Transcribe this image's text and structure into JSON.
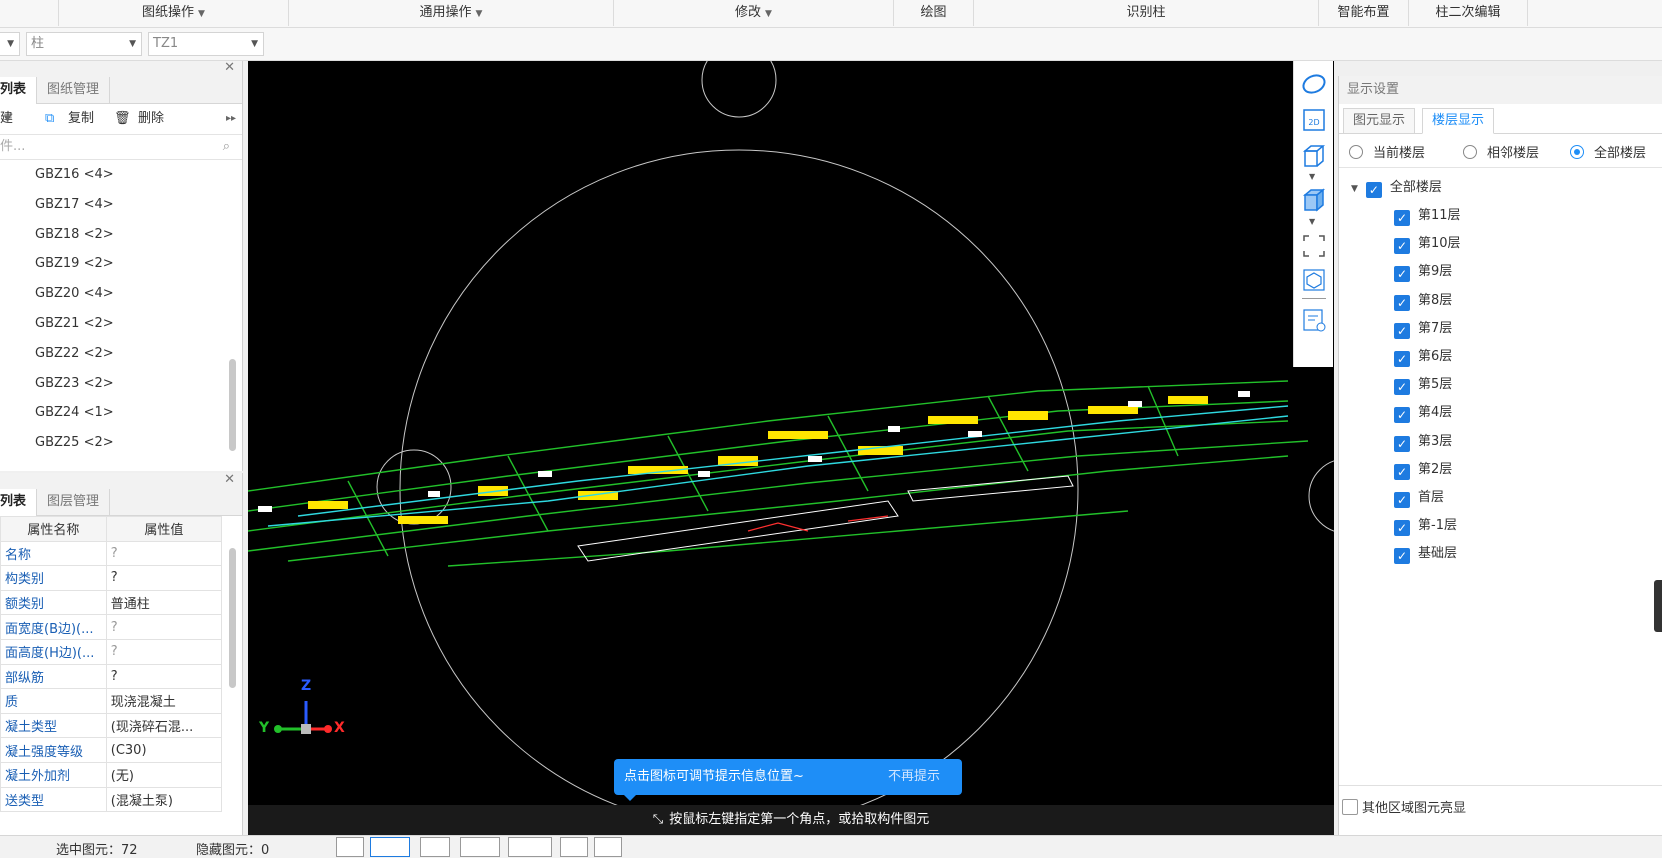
{
  "ribbon": {
    "groups": [
      {
        "label": "图纸操作",
        "dropdown": true
      },
      {
        "label": "通用操作",
        "dropdown": true
      },
      {
        "label": "修改",
        "dropdown": true
      },
      {
        "label": "绘图",
        "dropdown": false
      },
      {
        "label": "识别柱",
        "dropdown": false
      },
      {
        "label": "智能布置",
        "dropdown": false
      },
      {
        "label": "柱二次编辑",
        "dropdown": false
      }
    ]
  },
  "selectors": {
    "type": "柱",
    "name": "TZ1"
  },
  "component_panel": {
    "tabs": [
      "列表",
      "图纸管理"
    ],
    "toolbar": {
      "new": "建",
      "copy": "复制",
      "delete": "删除"
    },
    "search_placeholder": "件...",
    "items": [
      "GBZ16 <4>",
      "GBZ17 <4>",
      "GBZ18 <2>",
      "GBZ19 <2>",
      "GBZ20 <4>",
      "GBZ21 <2>",
      "GBZ22 <2>",
      "GBZ23 <2>",
      "GBZ24 <1>",
      "GBZ25 <2>"
    ]
  },
  "property_panel": {
    "tabs": [
      "列表",
      "图层管理"
    ],
    "headers": [
      "属性名称",
      "属性值"
    ],
    "rows": [
      {
        "name": "名称",
        "value": "?"
      },
      {
        "name": "构类别",
        "value": "?"
      },
      {
        "name": "额类别",
        "value": "普通柱"
      },
      {
        "name": "面宽度(B边)(...",
        "value": "?"
      },
      {
        "name": "面高度(H边)(...",
        "value": "?"
      },
      {
        "name": "部纵筋",
        "value": "?"
      },
      {
        "name": "质",
        "value": "现浇混凝土"
      },
      {
        "name": "凝土类型",
        "value": "(现浇碎石混..."
      },
      {
        "name": "凝土强度等级",
        "value": "(C30)"
      },
      {
        "name": "凝土外加剂",
        "value": "(无)"
      },
      {
        "name": "送类型",
        "value": "(混凝土泵)"
      }
    ]
  },
  "viewport": {
    "tip_text": "点击图标可调节提示信息位置~",
    "tip_dismiss": "不再提示",
    "status_prompt": "按鼠标左键指定第一个角点，或拾取构件图元",
    "axis_labels": {
      "x": "X",
      "y": "Y",
      "z": "Z"
    }
  },
  "view_toolbar": {
    "icons": [
      "orbit-icon",
      "2d-view-icon",
      "3d-box-icon",
      "3d-solid-icon",
      "fit-view-icon",
      "cube-icon",
      "display-list-icon"
    ]
  },
  "display_settings": {
    "title": "显示设置",
    "tabs": [
      "图元显示",
      "楼层显示"
    ],
    "active_tab": "楼层显示",
    "radio_options": [
      "当前楼层",
      "相邻楼层",
      "全部楼层"
    ],
    "radio_selected": "全部楼层",
    "root_label": "全部楼层",
    "floors": [
      "第11层",
      "第10层",
      "第9层",
      "第8层",
      "第7层",
      "第6层",
      "第5层",
      "第4层",
      "第3层",
      "第2层",
      "首层",
      "第-1层",
      "基础层"
    ],
    "other_area_label": "其他区域图元亮显"
  },
  "status_bar": {
    "selected_label": "选中图元：72",
    "hidden_label": "隐藏图元：0"
  },
  "colors": {
    "accent": "#1e8ef7",
    "viewport_bg": "#000000",
    "checkbox": "#1e7be0"
  }
}
